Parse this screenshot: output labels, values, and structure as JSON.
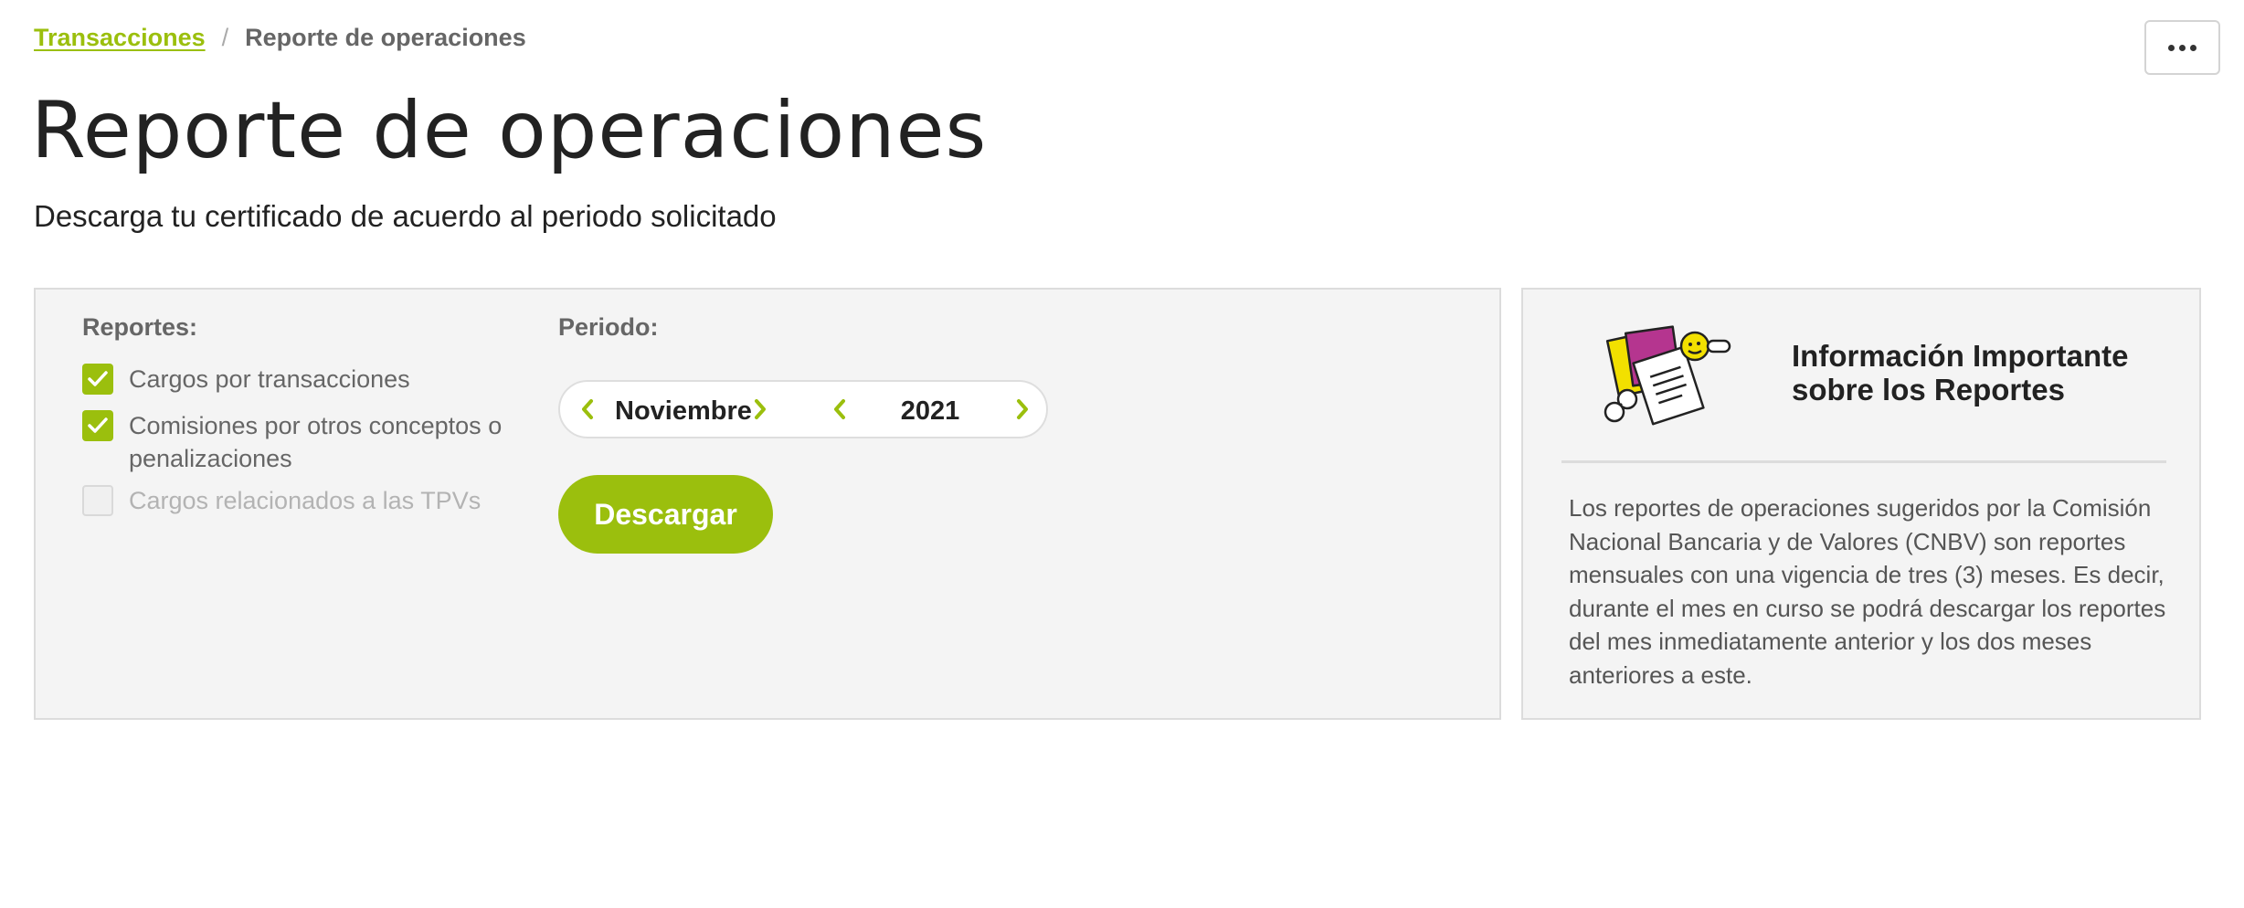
{
  "breadcrumb": {
    "parent": "Transacciones",
    "separator": "/",
    "current": "Reporte de operaciones"
  },
  "header": {
    "title": "Reporte de operaciones",
    "subtitle": "Descarga tu certificado de acuerdo al periodo solicitado",
    "more_icon": "ellipsis-icon"
  },
  "reports": {
    "label": "Reportes:",
    "options": [
      {
        "label": "Cargos por transacciones",
        "checked": true,
        "enabled": true
      },
      {
        "label": "Comisiones por otros conceptos o penalizaciones",
        "checked": true,
        "enabled": true
      },
      {
        "label": "Cargos relacionados a las TPVs",
        "checked": false,
        "enabled": false
      }
    ]
  },
  "period": {
    "label": "Periodo:",
    "month": "Noviembre",
    "year": "2021"
  },
  "actions": {
    "download_label": "Descargar"
  },
  "info": {
    "title": "Información Importante sobre los Reportes",
    "text": "Los reportes de operaciones sugeridos por la Comisión Nacional Bancaria y de Valores (CNBV) son reportes mensuales con una vigencia de tres (3) meses. Es decir, durante el mes en curso se podrá descargar los reportes del mes inmediatamente anterior y los dos meses anteriores a este.",
    "illustration_icon": "documents-illustration-icon"
  },
  "colors": {
    "accent": "#9bbf0d",
    "panel_bg": "#f4f4f4",
    "text_dark": "#222222",
    "text_muted": "#666666"
  }
}
